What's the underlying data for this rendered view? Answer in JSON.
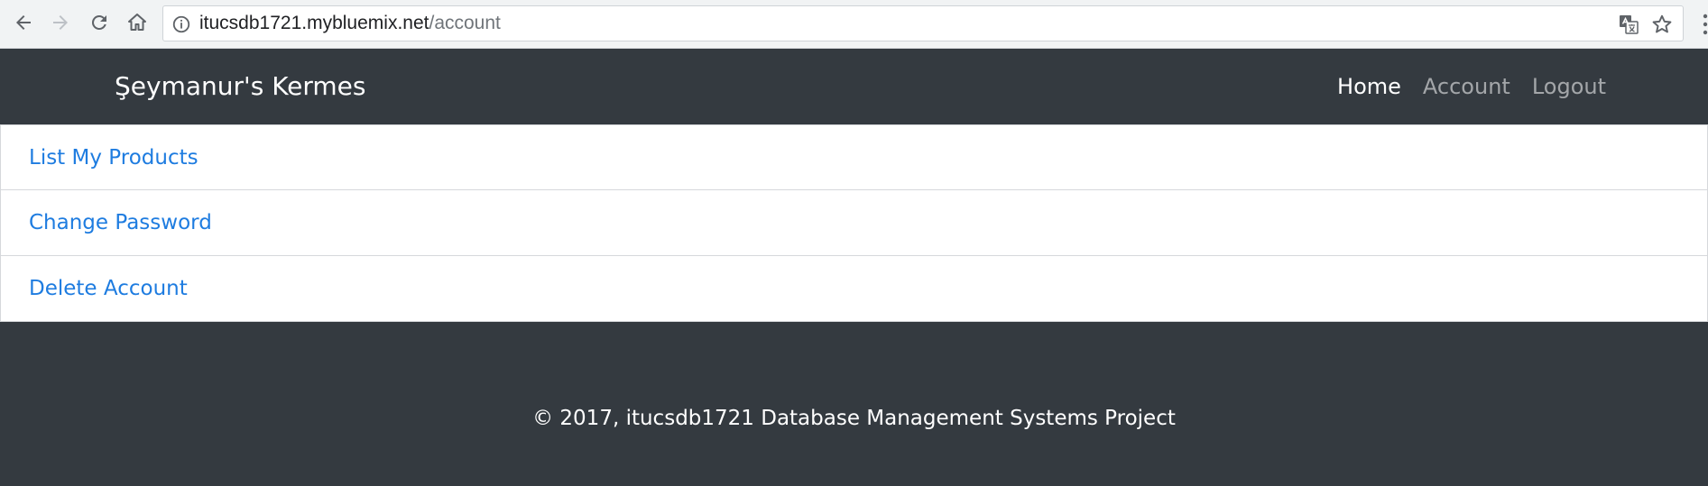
{
  "browser": {
    "url_host": "itucsdb1721.mybluemix.net",
    "url_path": "/account",
    "icons": [
      "back-icon",
      "forward-icon",
      "reload-icon",
      "home-icon",
      "info-icon",
      "translate-icon",
      "star-icon",
      "kebab-menu-icon"
    ]
  },
  "navbar": {
    "brand": "Şeymanur's Kermes",
    "links": [
      {
        "label": "Home",
        "active": true
      },
      {
        "label": "Account",
        "active": false
      },
      {
        "label": "Logout",
        "active": false
      }
    ]
  },
  "account_menu": {
    "items": [
      {
        "label": "List My Products"
      },
      {
        "label": "Change Password"
      },
      {
        "label": "Delete Account"
      }
    ]
  },
  "footer": {
    "text": "© 2017, itucsdb1721 Database Management Systems Project"
  },
  "colors": {
    "navbar_bg": "#343a40",
    "link_blue": "#1e7ce0",
    "nav_inactive": "rgba(255,255,255,0.55)"
  }
}
